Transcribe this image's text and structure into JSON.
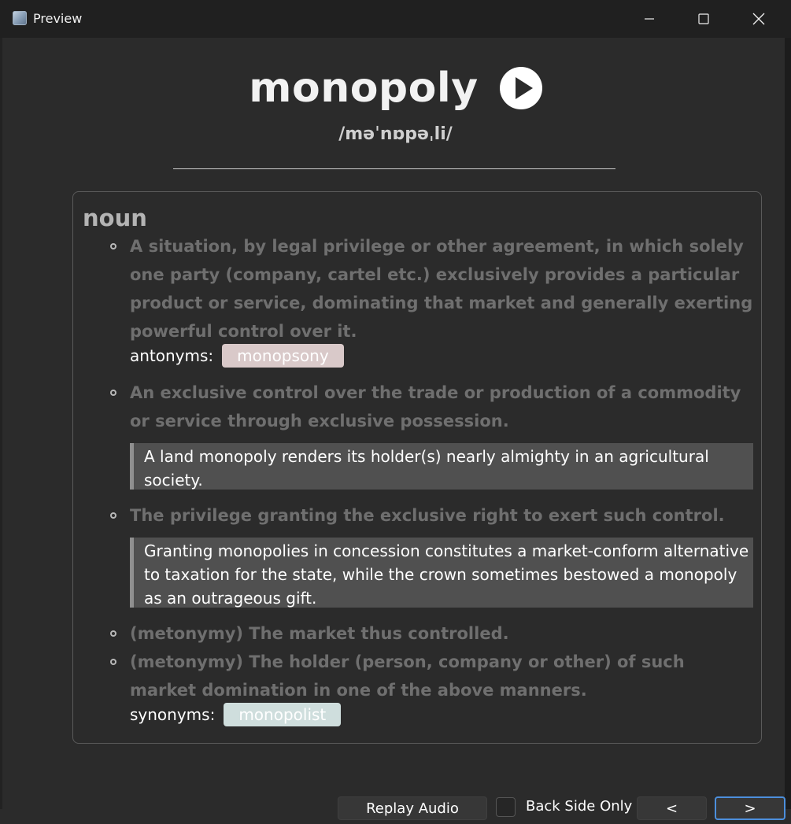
{
  "window": {
    "title": "Preview",
    "app_icon": "preview-app-icon",
    "controls": [
      "minimize-icon",
      "maximize-icon",
      "close-icon"
    ]
  },
  "entry": {
    "word": "monopoly",
    "phonetic": "/məˈnɒpəˌli/",
    "play_icon": "play-icon",
    "part_of_speech": "noun",
    "definitions": [
      {
        "text": "A situation, by legal privilege or other agreement, in which solely one party (company, cartel etc.) exclusively provides a particular product or service, dominating that market and generally exerting powerful control over it.",
        "antonyms_label": "antonyms:",
        "antonym": "monopsony"
      },
      {
        "text": "An exclusive control over the trade or production of a commodity or service through exclusive possession.",
        "example": "A land monopoly renders its holder(s) nearly almighty in an agricultural society."
      },
      {
        "text": "The privilege granting the exclusive right to exert such control.",
        "example": "Granting monopolies in concession constitutes a market-conform alternative to taxation for the state, while the crown sometimes bestowed a monopoly as an outrageous gift."
      },
      {
        "text": "(metonymy) The market thus controlled."
      },
      {
        "text": "(metonymy) The holder (person, company or other) of such market domination in one of the above manners.",
        "synonyms_label": "synonyms:",
        "synonym": "monopolist"
      }
    ]
  },
  "footer": {
    "replay_label": "Replay Audio",
    "back_side_only_label": "Back Side Only",
    "back_side_only_checked": false,
    "prev_label": "<",
    "next_label": ">"
  },
  "colors": {
    "background": "#2b2b2b",
    "titlebar": "#202020",
    "definition_text": "#6f6f6f",
    "example_bg": "#505050",
    "antonym_tag": "#d9c9c9",
    "synonym_tag": "#cfdedd",
    "focus_accent": "#4c8fdc"
  }
}
